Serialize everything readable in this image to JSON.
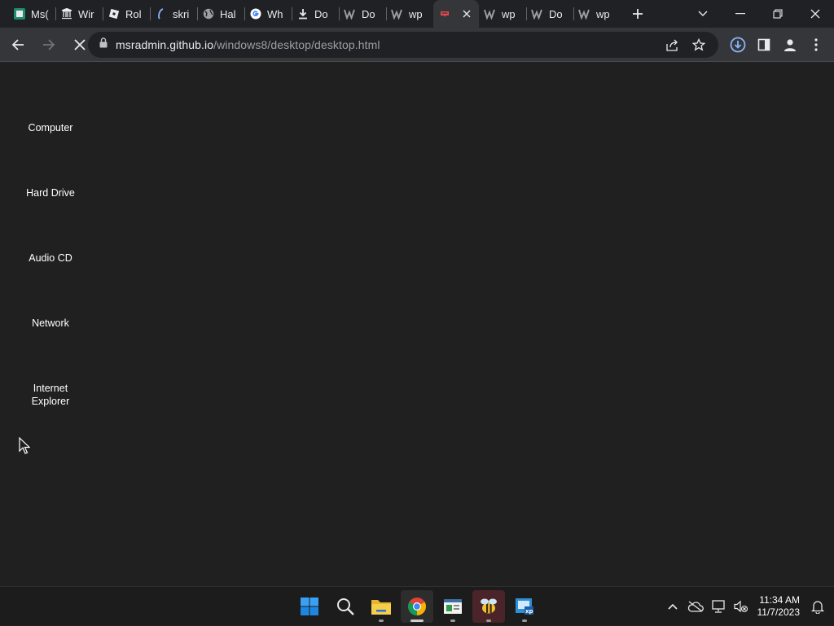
{
  "browser": {
    "tabs": [
      {
        "label": "Ms(",
        "icon": "msc-icon",
        "color": "#1e8e6e"
      },
      {
        "label": "Wir",
        "icon": "wikipedia-library-icon",
        "color": "#e8eaed"
      },
      {
        "label": "Rol",
        "icon": "roblox-icon",
        "color": "#e8eaed"
      },
      {
        "label": "skri",
        "icon": "skript-icon",
        "color": "#8ab4f8"
      },
      {
        "label": "Hal",
        "icon": "globe-icon",
        "color": "#9aa0a6"
      },
      {
        "label": "Wh",
        "icon": "google-icon",
        "color": "#4285f4"
      },
      {
        "label": "Do",
        "icon": "download-icon",
        "color": "#e8eaed"
      },
      {
        "label": "Do",
        "icon": "wordpress-icon",
        "color": "#9aa0a6"
      },
      {
        "label": "wp",
        "icon": "wordpress-icon",
        "color": "#9aa0a6"
      },
      {
        "label": "",
        "icon": "page-loading-icon",
        "color": "#e5484d",
        "active": true
      },
      {
        "label": "wp",
        "icon": "wordpress-icon",
        "color": "#9aa0a6"
      },
      {
        "label": "Do",
        "icon": "wordpress-icon",
        "color": "#9aa0a6"
      },
      {
        "label": "wp",
        "icon": "wordpress-icon",
        "color": "#9aa0a6"
      }
    ],
    "url_host": "msradmin.github.io",
    "url_path": "/windows8/desktop/desktop.html"
  },
  "desktop": {
    "icons": [
      {
        "label": "Computer"
      },
      {
        "label": "Hard Drive"
      },
      {
        "label": "Audio CD"
      },
      {
        "label": "Network"
      },
      {
        "label": "Internet\nExplorer"
      }
    ]
  },
  "taskbar": {
    "apps": [
      {
        "name": "start-button",
        "icon": "windows-logo-icon"
      },
      {
        "name": "search-button",
        "icon": "search-icon"
      },
      {
        "name": "file-explorer",
        "icon": "folder-icon"
      },
      {
        "name": "chrome",
        "icon": "chrome-icon"
      },
      {
        "name": "app-window",
        "icon": "window-app-icon"
      },
      {
        "name": "bee-app",
        "icon": "bee-icon"
      },
      {
        "name": "xp-app",
        "icon": "xp-icon"
      }
    ],
    "clock": {
      "time": "11:34 AM",
      "date": "11/7/2023"
    }
  },
  "colors": {
    "desktop_bg": "#202020",
    "toolbar_bg": "#35363a",
    "tabstrip_bg": "#202124"
  }
}
